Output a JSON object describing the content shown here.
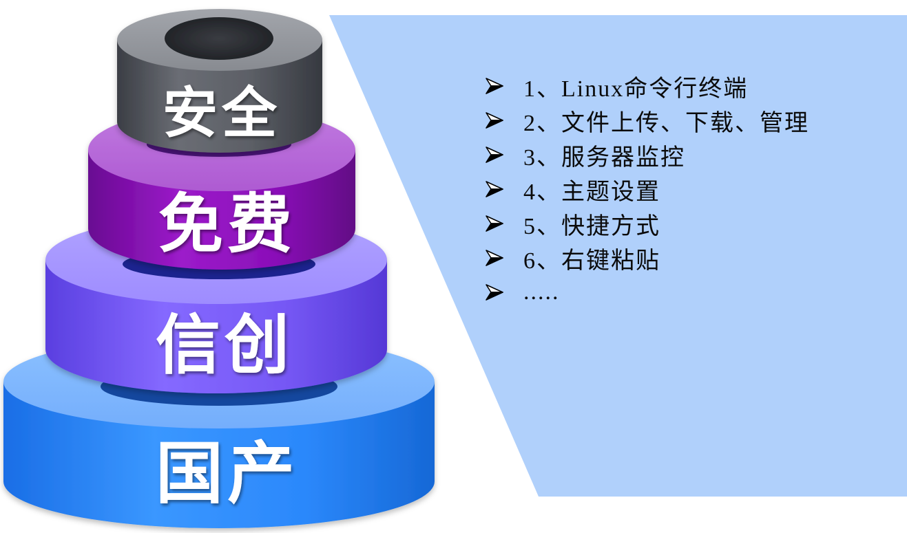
{
  "pyramid": {
    "layers": [
      {
        "label": "安全",
        "top_color": "#9a9da3",
        "body_color": "#5e6168"
      },
      {
        "label": "免费",
        "top_color": "#b566d6",
        "body_color": "#8c10bb"
      },
      {
        "label": "信创",
        "top_color": "#a899ff",
        "body_color": "#7a5cf8"
      },
      {
        "label": "国产",
        "top_color": "#80b9ff",
        "body_color": "#2d8cff"
      }
    ]
  },
  "panel": {
    "background_color": "#b0d0fb"
  },
  "features": {
    "bullet_icon": "arrow-bullet-icon",
    "items": [
      "1、Linux命令行终端",
      "2、文件上传、下载、管理",
      "3、服务器监控",
      "4、主题设置",
      "5、快捷方式",
      "6、右键粘贴",
      "....."
    ]
  }
}
